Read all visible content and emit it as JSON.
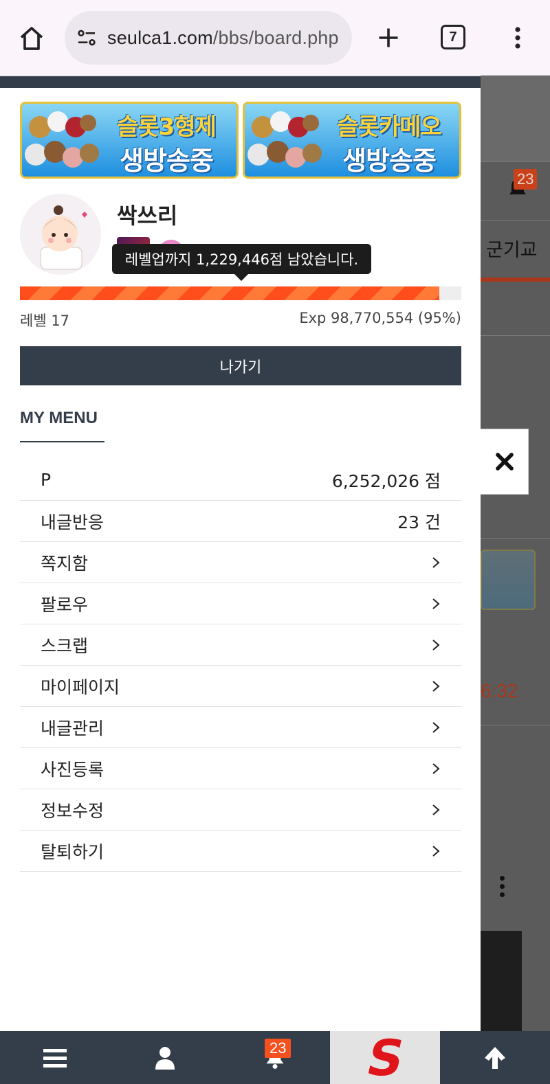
{
  "browser": {
    "url_domain": "seulca1.com",
    "url_path": "/bbs/board.php",
    "tab_count": "7"
  },
  "background_page": {
    "notification_count": "23",
    "menu_fragment": "군기교",
    "time_fragment": "6:32"
  },
  "banners": [
    {
      "line1": "슬롯3형제",
      "line2": "생방송중"
    },
    {
      "line1": "슬롯카메오",
      "line2": "생방송중"
    }
  ],
  "profile": {
    "nickname": "싹쓰리",
    "tooltip": "레벨업까지 1,229,446점 남았습니다.",
    "level_label": "레벨 17",
    "exp_label": "Exp 98,770,554 (95%)",
    "progress_percent": 95,
    "logout_label": "나가기"
  },
  "my_menu": {
    "title": "MY MENU",
    "items": [
      {
        "label": "P",
        "value": "6,252,026 점"
      },
      {
        "label": "내글반응",
        "value": "23 건"
      },
      {
        "label": "쪽지함"
      },
      {
        "label": "팔로우"
      },
      {
        "label": "스크랩"
      },
      {
        "label": "마이페이지"
      },
      {
        "label": "내글관리"
      },
      {
        "label": "사진등록"
      },
      {
        "label": "정보수정"
      },
      {
        "label": "탈퇴하기"
      }
    ]
  },
  "bottom_nav": {
    "notification_count": "23",
    "logo_letter": "S"
  },
  "colors": {
    "navy": "#343e4a",
    "accent_orange": "#ff4d1c",
    "badge_orange": "#f4511e"
  }
}
